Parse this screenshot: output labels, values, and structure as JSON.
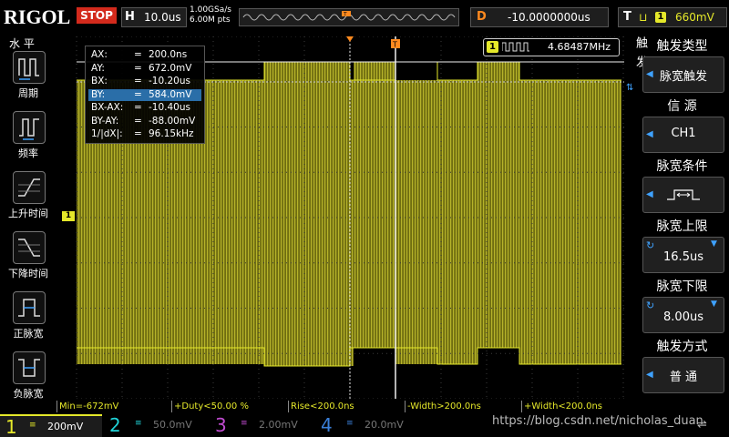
{
  "topbar": {
    "brand": "RIGOL",
    "run_state": "STOP",
    "horizontal": {
      "label": "H",
      "value": "10.0us"
    },
    "sample_rate": "1.00GSa/s",
    "memory_depth": "6.00M pts",
    "delay": {
      "label": "D",
      "value": "-10.0000000us"
    },
    "trigger": {
      "label": "T",
      "source": "1",
      "level": "660mV"
    }
  },
  "left_panel": {
    "title": "水 平",
    "buttons": [
      {
        "label": "周期",
        "icon": "period-icon"
      },
      {
        "label": "频率",
        "icon": "frequency-icon"
      },
      {
        "label": "上升时间",
        "icon": "rise-time-icon"
      },
      {
        "label": "下降时间",
        "icon": "fall-time-icon"
      },
      {
        "label": "正脉宽",
        "icon": "positive-width-icon"
      },
      {
        "label": "负脉宽",
        "icon": "negative-width-icon"
      }
    ]
  },
  "cursor_readout": [
    {
      "key": "AX:",
      "value": "200.0ns"
    },
    {
      "key": "AY:",
      "value": "672.0mV"
    },
    {
      "key": "BX:",
      "value": "-10.20us"
    },
    {
      "key": "BY:",
      "value": "584.0mV"
    },
    {
      "key": "BX-AX:",
      "value": "-10.40us"
    },
    {
      "key": "BY-AY:",
      "value": "-88.00mV"
    },
    {
      "key": "1/|dX|:",
      "value": "96.15kHz"
    }
  ],
  "frequency_counter": {
    "channel": "1",
    "value": "4.68487MHz"
  },
  "channel_marker": "1",
  "right_menu": {
    "side_label": "触发",
    "items": [
      {
        "title": "触发类型",
        "value": "脉宽触发"
      },
      {
        "title": "信 源",
        "value": "CH1"
      },
      {
        "title": "脉宽条件",
        "value": ""
      },
      {
        "title": "脉宽上限",
        "value": "16.5us"
      },
      {
        "title": "脉宽下限",
        "value": "8.00us"
      },
      {
        "title": "触发方式",
        "value": "普 通"
      }
    ]
  },
  "measurements": [
    "Min=-672mV",
    "+Duty<50.00 %",
    "Rise<200.0ns",
    "-Width>200.0ns",
    "+Width<200.0ns"
  ],
  "channels": [
    {
      "num": "1",
      "scale": "200mV",
      "color": "#e5e82a"
    },
    {
      "num": "2",
      "scale": "50.0mV",
      "color": "#1fd3d8"
    },
    {
      "num": "3",
      "scale": "2.00mV",
      "color": "#c04bd0"
    },
    {
      "num": "4",
      "scale": "20.0mV",
      "color": "#3a7fd8"
    }
  ],
  "watermark": "https://blog.csdn.net/nicholas_duan",
  "colors": {
    "waveform": "#8c8a16",
    "waveform_edge": "#d8d63a",
    "accent_orange": "#ff8a1f",
    "accent_blue": "#3fa2ff",
    "stop_red": "#d32a1c"
  }
}
